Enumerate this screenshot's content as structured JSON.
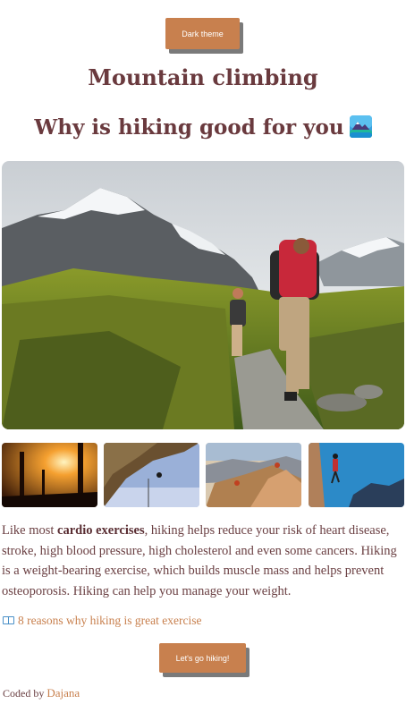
{
  "theme_button": {
    "label": "Dark theme"
  },
  "title": "Mountain climbing",
  "subtitle": "Why is hiking good for you",
  "emoji_icon": "mountain-landscape-icon",
  "hero_image": "hikers-on-mountain-trail",
  "thumbnails": [
    "sunset-forest-hikers",
    "rock-climber-overhang",
    "climbers-on-ridge",
    "climber-on-cliff-blue-sky"
  ],
  "description": {
    "before": "Like most ",
    "bold": "cardio exercises",
    "after": ", hiking helps reduce your risk of heart disease, stroke, high blood pressure, high cholesterol and even some cancers. Hiking is a weight-bearing exercise, which builds muscle mass and helps prevent osteoporosis. Hiking can help you manage your weight."
  },
  "link": {
    "icon": "book-icon",
    "text": "8 reasons why hiking is great exercise"
  },
  "go_button": {
    "label": "Let's go hiking!"
  },
  "footer": {
    "prefix": "Coded by",
    "author": "Dajana"
  },
  "colors": {
    "accent": "#c8804e",
    "heading": "#6a3a3e",
    "shadow": "#7a7a7a"
  }
}
